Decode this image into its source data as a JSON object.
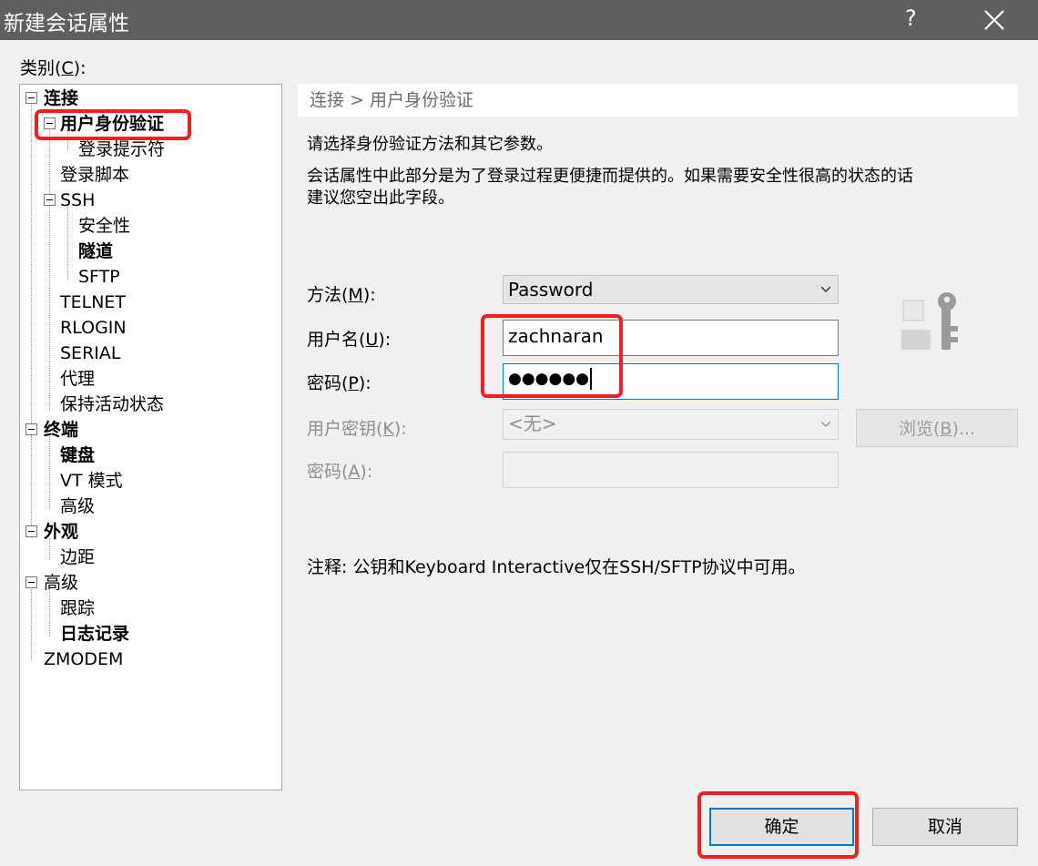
{
  "dialog": {
    "title": "新建会话属性",
    "help": "?"
  },
  "category": {
    "label": "类别(",
    "accel": "C",
    "suffix": "):"
  },
  "tree": {
    "connection": "连接",
    "auth": "用户身份验证",
    "login_prompt": "登录提示符",
    "login_script": "登录脚本",
    "ssh": "SSH",
    "security": "安全性",
    "tunnel": "隧道",
    "sftp": "SFTP",
    "telnet": "TELNET",
    "rlogin": "RLOGIN",
    "serial": "SERIAL",
    "proxy": "代理",
    "keepalive": "保持活动状态",
    "terminal": "终端",
    "keyboard": "键盘",
    "vt_mode": "VT 模式",
    "advanced_term": "高级",
    "appearance": "外观",
    "margin": "边距",
    "advanced": "高级",
    "trace": "跟踪",
    "logging": "日志记录",
    "zmodem": "ZMODEM"
  },
  "breadcrumb": "连接 > 用户身份验证",
  "description": {
    "line1": "请选择身份验证方法和其它参数。",
    "line2": "会话属性中此部分是为了登录过程更便捷而提供的。如果需要安全性很高的状态的话",
    "line3": "建议您空出此字段。"
  },
  "form": {
    "method": {
      "label": "方法(",
      "accel": "M",
      "suffix": "):",
      "value": "Password"
    },
    "username": {
      "label": "用户名(",
      "accel": "U",
      "suffix": "):",
      "value": "zachnaran"
    },
    "password": {
      "label": "密码(",
      "accel": "P",
      "suffix": "):",
      "value": "●●●●●●"
    },
    "user_key": {
      "label": "用户密钥(",
      "accel": "K",
      "suffix": "):",
      "value": "<无>"
    },
    "passphrase": {
      "label": "密码(",
      "accel": "A",
      "suffix": "):",
      "value": ""
    },
    "browse": {
      "label": "浏览(",
      "accel": "B",
      "suffix": ")..."
    }
  },
  "note": "注释: 公钥和Keyboard Interactive仅在SSH/SFTP协议中可用。",
  "buttons": {
    "ok": "确定",
    "cancel": "取消"
  },
  "colors": {
    "titlebar": "#5f5f5f",
    "highlight": "#f02020",
    "focus": "#0078d7"
  }
}
